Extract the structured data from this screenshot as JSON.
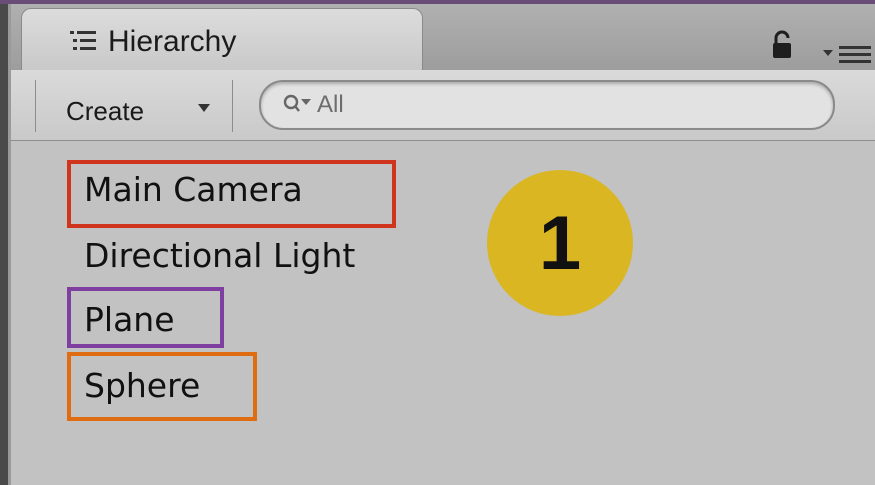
{
  "panel": {
    "tab_title": "Hierarchy",
    "icons": [
      "hierarchy-list-icon",
      "lock-icon",
      "panel-menu-icon"
    ]
  },
  "toolbar": {
    "create_label": "Create",
    "search": {
      "placeholder": "All",
      "value": ""
    }
  },
  "hierarchy": {
    "items": [
      "Main Camera",
      "Directional Light",
      "Plane",
      "Sphere"
    ]
  },
  "annotations": {
    "badge_label": "1",
    "colors": {
      "main_camera": "#d0341c",
      "plane": "#7f3fa0",
      "sphere": "#e06c12",
      "badge": "#d9b622"
    }
  }
}
